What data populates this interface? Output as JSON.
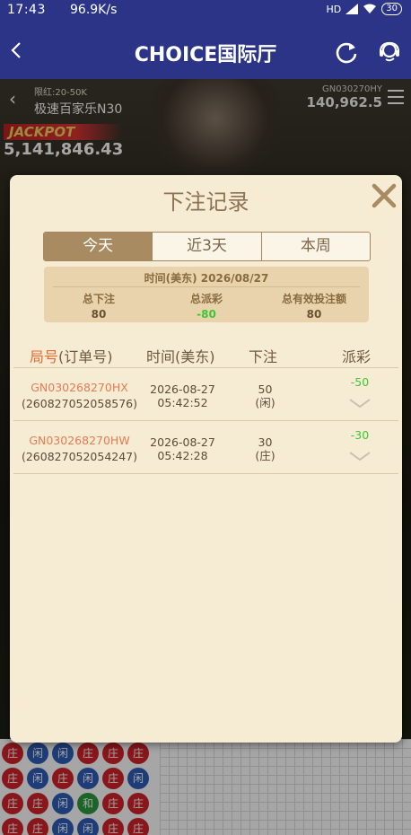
{
  "status_bar": {
    "time": "17:43",
    "net_speed": "96.9K/s",
    "signal": "HD",
    "battery": "30"
  },
  "app_bar": {
    "title": "CHOICE国际厅"
  },
  "background": {
    "table_limit": "限红:20-50K",
    "table_name": "极速百家乐N30",
    "round_id": "GN030270HY",
    "balance": "140,962.5",
    "jackpot_label": "JACKPOT",
    "jackpot_value": "5,141,846.43"
  },
  "bead_road": [
    "red",
    "blue",
    "blue",
    "red",
    "red",
    "red",
    "red",
    "blue",
    "red",
    "blue",
    "red",
    "blue",
    "red",
    "red",
    "blue",
    "green",
    "red",
    "red",
    "red",
    "red",
    "blue",
    "blue",
    "red",
    "red"
  ],
  "bead_road_labels": {
    "red": "庄",
    "blue": "闲",
    "green": "和"
  },
  "modal": {
    "title": "下注记录",
    "tabs": [
      "今天",
      "近3天",
      "本周"
    ],
    "active_tab": 0,
    "summary": {
      "date_line": "时间(美东) 2026/08/27",
      "total_bet_label": "总下注",
      "total_bet": "80",
      "total_payout_label": "总派彩",
      "total_payout": "-80",
      "valid_bet_label": "总有效投注额",
      "valid_bet": "80"
    },
    "columns": {
      "round_prefix": "局号",
      "round_suffix": "(订单号)",
      "time": "时间(美东)",
      "bet": "下注",
      "payout": "派彩"
    },
    "rows": [
      {
        "round_id": "GN030268270HX",
        "order_no": "(260827052058576)",
        "date": "2026-08-27",
        "time": "05:42:52",
        "amount": "50",
        "side": "(闲)",
        "payout": "-50"
      },
      {
        "round_id": "GN030268270HW",
        "order_no": "(260827052054247)",
        "date": "2026-08-27",
        "time": "05:42:28",
        "amount": "30",
        "side": "(庄)",
        "payout": "-30"
      }
    ]
  },
  "colors": {
    "header": "#2c3487",
    "modal_bg": "#f6ebd3",
    "accent": "#a88b61",
    "win_green": "#3ec734",
    "round_id": "#e37d53"
  }
}
